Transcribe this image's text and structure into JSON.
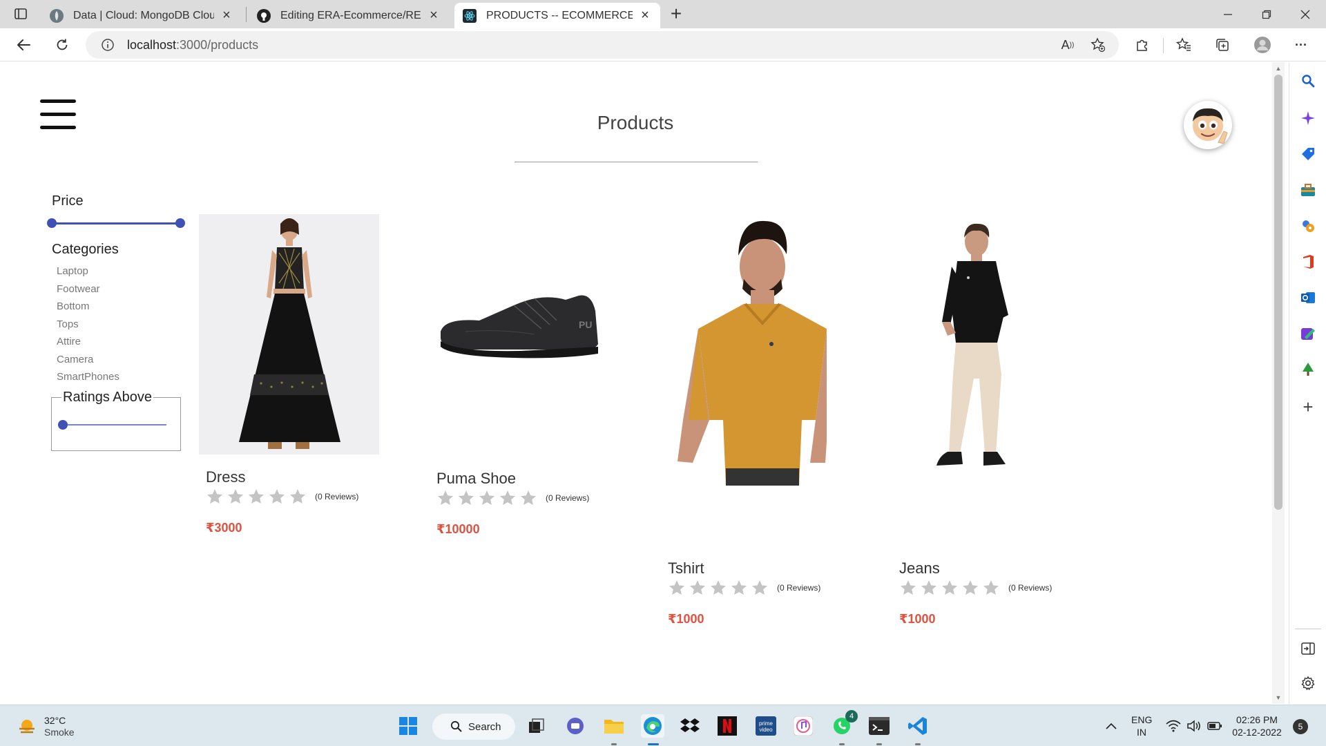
{
  "browser": {
    "tabs": [
      {
        "title": "Data | Cloud: MongoDB Cloud",
        "active": false
      },
      {
        "title": "Editing ERA-Ecommerce/README.md",
        "active": false
      },
      {
        "title": "PRODUCTS -- ECOMMERCE",
        "active": true
      }
    ],
    "url_host": "localhost",
    "url_rest": ":3000/products"
  },
  "page": {
    "title": "Products",
    "filters": {
      "price_label": "Price",
      "price_range": [
        0,
        25000
      ],
      "categories_label": "Categories",
      "categories": [
        "Laptop",
        "Footwear",
        "Bottom",
        "Tops",
        "Attire",
        "Camera",
        "SmartPhones"
      ],
      "ratings_label": "Ratings Above",
      "ratings_value": 0
    },
    "products": [
      {
        "name": "Dress",
        "reviews": "(0 Reviews)",
        "price": "₹3000",
        "rating": 0
      },
      {
        "name": "Puma Shoe",
        "reviews": "(0 Reviews)",
        "price": "₹10000",
        "rating": 0
      },
      {
        "name": "Tshirt",
        "reviews": "(0 Reviews)",
        "price": "₹1000",
        "rating": 0
      },
      {
        "name": "Jeans",
        "reviews": "(0 Reviews)",
        "price": "₹1000",
        "rating": 0
      }
    ]
  },
  "taskbar": {
    "weather_temp": "32°C",
    "weather_cond": "Smoke",
    "search_label": "Search",
    "whatsapp_badge": "4",
    "lang_1": "ENG",
    "lang_2": "IN",
    "time": "02:26 PM",
    "date": "02-12-2022",
    "notification_count": "5"
  },
  "colors": {
    "accent": "#3f51b5",
    "price": "#e2503f",
    "star_empty": "#c4c4c4"
  }
}
